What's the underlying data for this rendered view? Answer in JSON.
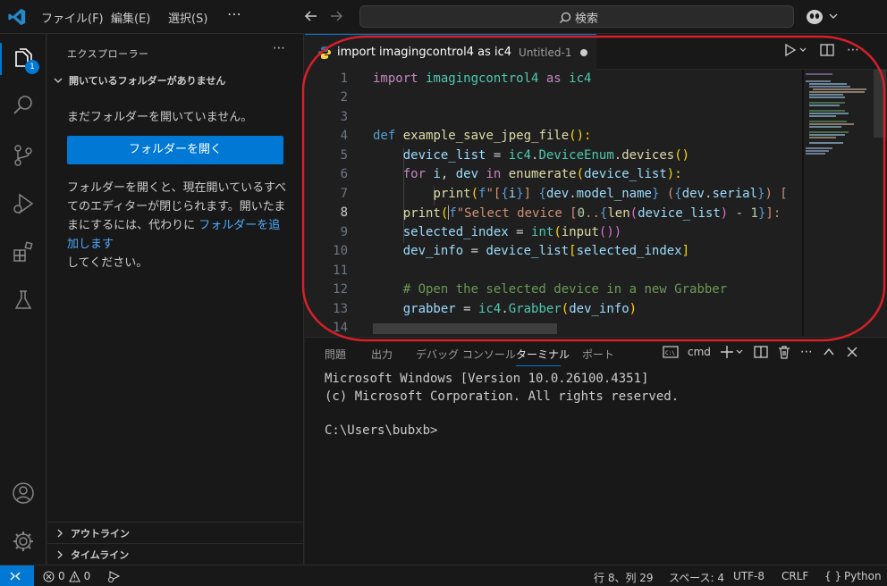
{
  "titlebar": {
    "menus": [
      "ファイル(F)",
      "編集(E)",
      "選択(S)"
    ],
    "more": "⋯",
    "search_placeholder": "検索",
    "icons": [
      "vscode-logo",
      "back-arrow",
      "forward-arrow",
      "search",
      "copilot"
    ]
  },
  "activity": {
    "items": [
      "explorer",
      "search",
      "source-control",
      "run-and-debug",
      "extensions",
      "testing",
      "accounts",
      "manage"
    ],
    "explorer_badge": "1"
  },
  "sidebar": {
    "title": "エクスプローラー",
    "more": "⋯",
    "section": "開いているフォルダーがありません",
    "empty_message": "まだフォルダーを開いていません。",
    "open_folder_button": "フォルダーを開く",
    "desc_part1": "フォルダーを開くと、現在開いているすべてのエディターが閉じられます。開いたままにするには、代わりに",
    "desc_link": "フォルダーを追加します",
    "desc_part2": "してください。",
    "outline": "アウトライン",
    "timeline": "タイムライン"
  },
  "editor": {
    "tab_label": "import imagingcontrol4 as ic4",
    "tab_desc": "Untitled-1",
    "line_numbers": [
      "1",
      "2",
      "3",
      "4",
      "5",
      "6",
      "7",
      "8",
      "9",
      "10",
      "11",
      "12",
      "13",
      "14"
    ],
    "active_line": "8",
    "code": {
      "l1_kw": "import",
      "l1_mod": " imagingcontrol4 ",
      "l1_as": "as",
      "l1_alias": " ic4",
      "l4_def": "def",
      "l4_fn": " example_save_jpeg_file",
      "l4_rest": "():",
      "l5_var": "device_list",
      "l5_eq": " = ",
      "l5_mod": "ic4",
      "l5_dot": ".",
      "l5_cls": "DeviceEnum",
      "l5_dot2": ".",
      "l5_fn": "devices",
      "l5_p": "()",
      "l6_for": "for",
      "l6_i": " i",
      "l6_c": ", ",
      "l6_dev": "dev",
      "l6_in": " in",
      "l6_fn": " enumerate",
      "l6_p1": "(",
      "l6_arg": "device_list",
      "l6_p2": "):",
      "l7_fn": "print",
      "l7_p1": "(",
      "l7_f": "f",
      "l7_s1": "\"[",
      "l7_b1": "{",
      "l7_i": "i",
      "l7_b2": "}",
      "l7_s2": "] ",
      "l7_b3": "{",
      "l7_dev": "dev",
      "l7_dot": ".",
      "l7_mn": "model_name",
      "l7_b4": "}",
      "l7_s3": " (",
      "l7_b5": "{",
      "l7_dev2": "dev",
      "l7_dot2": ".",
      "l7_ser": "serial",
      "l7_b6": "}",
      "l7_s4": ") [",
      "l8_fn": "print",
      "l8_p1": "(",
      "l8_f": "f",
      "l8_s1": "\"Select device [",
      "l8_n0": "0",
      "l8_s2": "..",
      "l8_b1": "{",
      "l8_len": "len",
      "l8_p2": "(",
      "l8_arg": "device_list",
      "l8_p3": ")",
      "l8_op": " - ",
      "l8_n1": "1",
      "l8_b2": "}",
      "l8_s3": "]: ",
      "l9_var": "selected_index",
      "l9_eq": " = ",
      "l9_int": "int",
      "l9_p1": "(",
      "l9_inp": "input",
      "l9_p2": "())",
      "l10_var": "dev_info",
      "l10_eq": " = ",
      "l10_arr": "device_list",
      "l10_b1": "[",
      "l10_idx": "selected_index",
      "l10_b2": "]",
      "l12_com": "# Open the selected device in a new Grabber",
      "l13_var": "grabber",
      "l13_eq": " = ",
      "l13_mod": "ic4",
      "l13_dot": ".",
      "l13_cls": "Grabber",
      "l13_p1": "(",
      "l13_arg": "dev_info",
      "l13_p2": ")"
    }
  },
  "panel": {
    "tabs": [
      "問題",
      "出力",
      "デバッグ コンソール",
      "ターミナル",
      "ポート"
    ],
    "active_tab": "ターミナル",
    "shell": "cmd",
    "terminal_lines": [
      "Microsoft Windows [Version 10.0.26100.4351]",
      "(c) Microsoft Corporation. All rights reserved.",
      "",
      "C:\\Users\\bubxb>"
    ]
  },
  "status": {
    "errors": "0",
    "warnings": "0",
    "position": "行 8、列 29",
    "spaces": "スペース: 4",
    "encoding": "UTF-8",
    "eol": "CRLF",
    "language": "Python",
    "language_braces": "{ }"
  },
  "colors": {
    "accent": "#0078d4",
    "annotation": "#d81f2a"
  }
}
